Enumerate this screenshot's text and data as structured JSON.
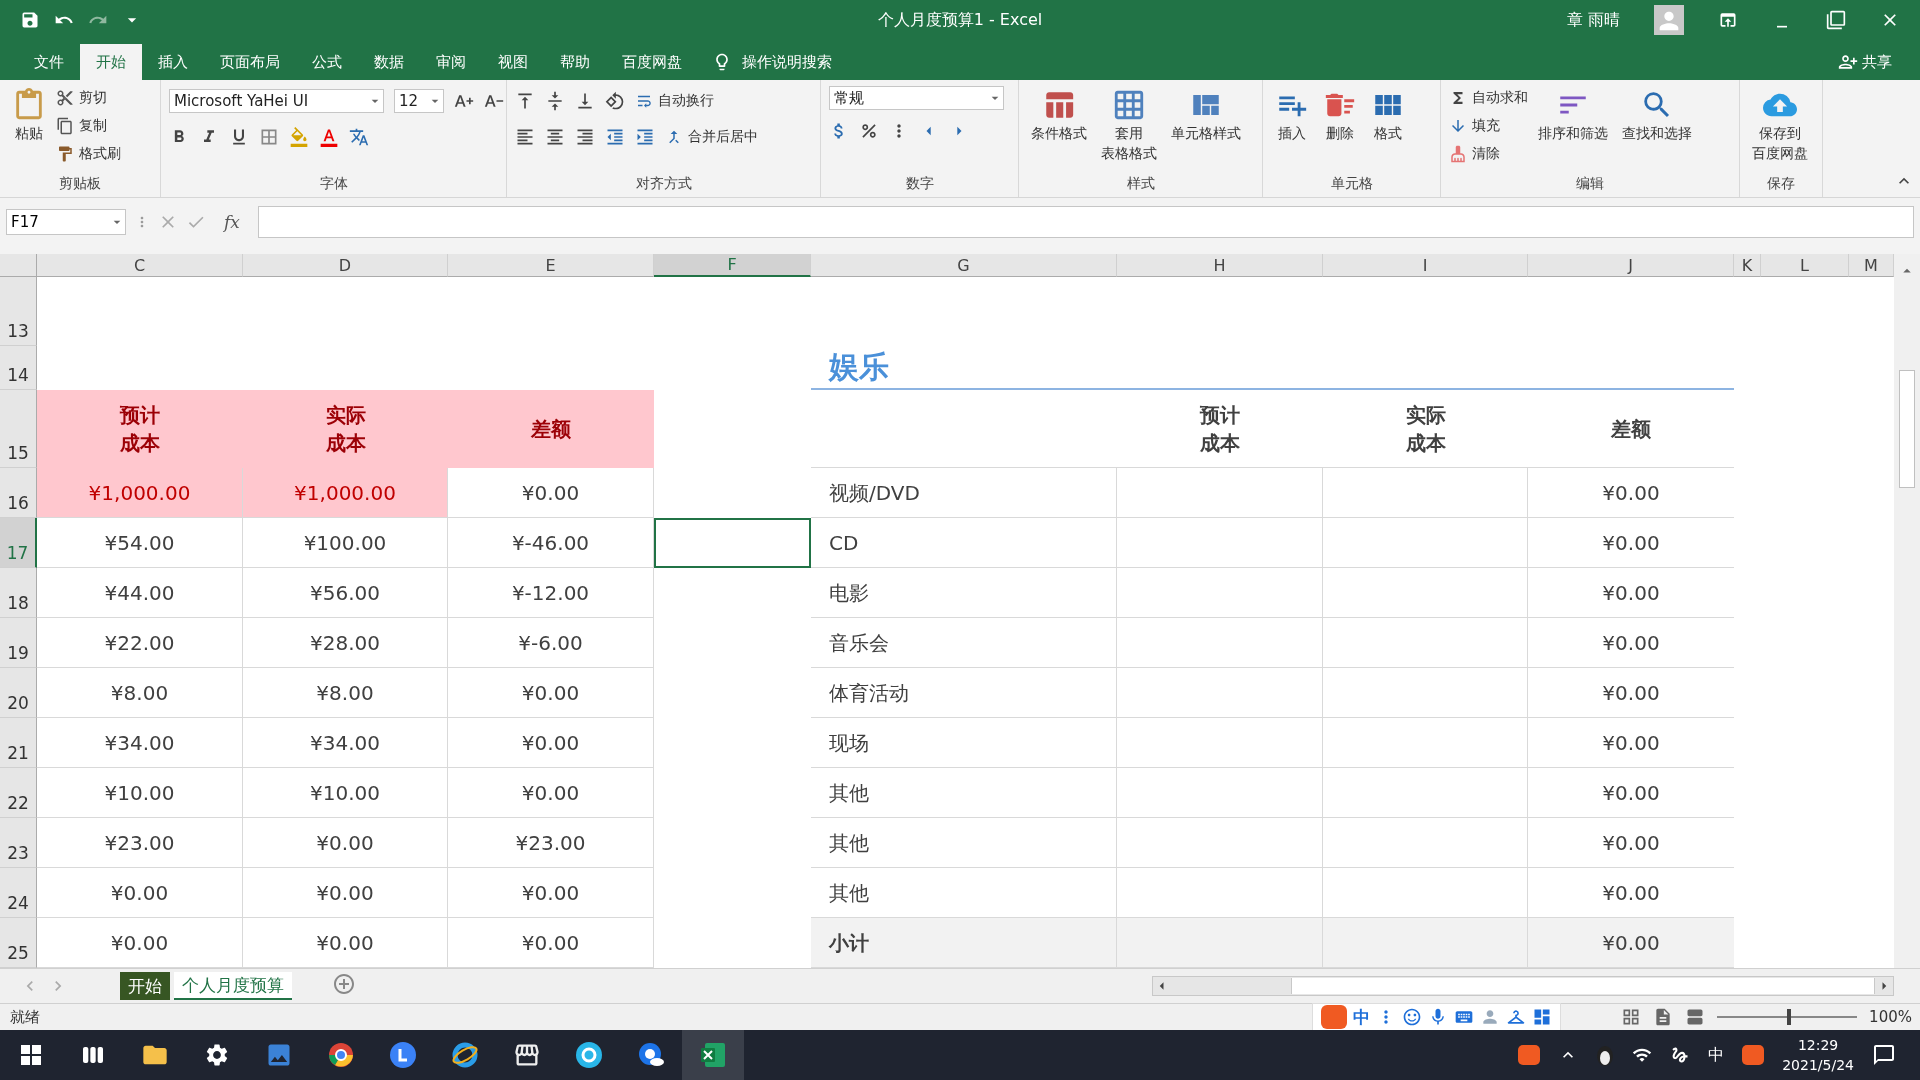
{
  "title_bar": {
    "title": "个人月度预算1 - Excel",
    "user": "章 雨晴"
  },
  "menu_tabs": [
    {
      "label": "文件",
      "selected": false
    },
    {
      "label": "开始",
      "selected": true
    },
    {
      "label": "插入",
      "selected": false
    },
    {
      "label": "页面布局",
      "selected": false
    },
    {
      "label": "公式",
      "selected": false
    },
    {
      "label": "数据",
      "selected": false
    },
    {
      "label": "审阅",
      "selected": false
    },
    {
      "label": "视图",
      "selected": false
    },
    {
      "label": "帮助",
      "selected": false
    },
    {
      "label": "百度网盘",
      "selected": false
    }
  ],
  "tell_me": "操作说明搜索",
  "share": "共享",
  "ribbon": [
    {
      "kind": "clipboard",
      "label": "剪贴板",
      "buttons": [
        [
          "粘贴"
        ],
        [
          "剪切"
        ],
        [
          "复制"
        ],
        [
          "格式刷"
        ]
      ]
    },
    {
      "kind": "font",
      "label": "字体",
      "font": "Microsoft YaHei UI",
      "size": "12"
    },
    {
      "kind": "alignment",
      "label": "对齐方式",
      "buttons": [
        [
          "自动换行"
        ],
        [
          "合并后居中"
        ]
      ]
    },
    {
      "kind": "number",
      "label": "数字",
      "format": "常规"
    },
    {
      "kind": "styles",
      "label": "样式",
      "buttons": [
        [
          "条件格式"
        ],
        [
          "套用",
          "表格格式"
        ],
        [
          "单元格样式"
        ]
      ]
    },
    {
      "kind": "cells",
      "label": "单元格",
      "buttons": [
        [
          "插入"
        ],
        [
          "删除"
        ],
        [
          "格式"
        ]
      ]
    },
    {
      "kind": "editing",
      "label": "编辑",
      "buttons": [
        [
          "自动求和"
        ],
        [
          "填充"
        ],
        [
          "清除"
        ],
        [
          "排序和筛选"
        ],
        [
          "查找和选择"
        ]
      ]
    },
    {
      "kind": "save",
      "label": "保存",
      "buttons": [
        [
          "保存到",
          "百度网盘"
        ]
      ]
    }
  ],
  "name_box": "F17",
  "fx": "fx",
  "columns": [
    {
      "label": "C",
      "selected": false
    },
    {
      "label": "D",
      "selected": false
    },
    {
      "label": "E",
      "selected": false
    },
    {
      "label": "F",
      "selected": true
    },
    {
      "label": "G",
      "selected": false
    },
    {
      "label": "H",
      "selected": false
    },
    {
      "label": "I",
      "selected": false
    },
    {
      "label": "J",
      "selected": false
    },
    {
      "label": "K",
      "selected": false
    },
    {
      "label": "L",
      "selected": false
    },
    {
      "label": "M",
      "selected": false
    }
  ],
  "rows": [
    {
      "number": "13",
      "selected": false
    },
    {
      "number": "14",
      "selected": false,
      "right": {
        "kind": "title",
        "label": "娱乐"
      }
    },
    {
      "number": "15",
      "selected": false,
      "left": [
        {
          "text": "预计成本",
          "kind": "header"
        },
        {
          "text": "实际成本",
          "kind": "header"
        },
        {
          "text": "差额",
          "kind": "header"
        }
      ],
      "right": {
        "kind": "head",
        "estimate": "预计成本",
        "actual": "实际成本",
        "difference": "差额"
      }
    },
    {
      "number": "16",
      "selected": false,
      "left": [
        {
          "text": "¥1,000.00",
          "kind": "highlight"
        },
        {
          "text": "¥1,000.00",
          "kind": "highlight"
        },
        {
          "text": "¥0.00",
          "kind": "value"
        }
      ],
      "right": {
        "kind": "body",
        "label": "视频/DVD",
        "difference": "¥0.00"
      }
    },
    {
      "number": "17",
      "selected": true,
      "left": [
        {
          "text": "¥54.00",
          "kind": "value"
        },
        {
          "text": "¥100.00",
          "kind": "value"
        },
        {
          "text": "¥-46.00",
          "kind": "value"
        }
      ],
      "right": {
        "kind": "body",
        "label": "CD",
        "difference": "¥0.00"
      }
    },
    {
      "number": "18",
      "selected": false,
      "left": [
        {
          "text": "¥44.00",
          "kind": "value"
        },
        {
          "text": "¥56.00",
          "kind": "value"
        },
        {
          "text": "¥-12.00",
          "kind": "value"
        }
      ],
      "right": {
        "kind": "body",
        "label": "电影",
        "difference": "¥0.00"
      }
    },
    {
      "number": "19",
      "selected": false,
      "left": [
        {
          "text": "¥22.00",
          "kind": "value"
        },
        {
          "text": "¥28.00",
          "kind": "value"
        },
        {
          "text": "¥-6.00",
          "kind": "value"
        }
      ],
      "right": {
        "kind": "body",
        "label": "音乐会",
        "difference": "¥0.00"
      }
    },
    {
      "number": "20",
      "selected": false,
      "left": [
        {
          "text": "¥8.00",
          "kind": "value"
        },
        {
          "text": "¥8.00",
          "kind": "value"
        },
        {
          "text": "¥0.00",
          "kind": "value"
        }
      ],
      "right": {
        "kind": "body",
        "label": "体育活动",
        "difference": "¥0.00"
      }
    },
    {
      "number": "21",
      "selected": false,
      "left": [
        {
          "text": "¥34.00",
          "kind": "value"
        },
        {
          "text": "¥34.00",
          "kind": "value"
        },
        {
          "text": "¥0.00",
          "kind": "value"
        }
      ],
      "right": {
        "kind": "body",
        "label": "现场",
        "difference": "¥0.00"
      }
    },
    {
      "number": "22",
      "selected": false,
      "left": [
        {
          "text": "¥10.00",
          "kind": "value"
        },
        {
          "text": "¥10.00",
          "kind": "value"
        },
        {
          "text": "¥0.00",
          "kind": "value"
        }
      ],
      "right": {
        "kind": "body",
        "label": "其他",
        "difference": "¥0.00"
      }
    },
    {
      "number": "23",
      "selected": false,
      "left": [
        {
          "text": "¥23.00",
          "kind": "value"
        },
        {
          "text": "¥0.00",
          "kind": "value"
        },
        {
          "text": "¥23.00",
          "kind": "value"
        }
      ],
      "right": {
        "kind": "body",
        "label": "其他",
        "difference": "¥0.00"
      }
    },
    {
      "number": "24",
      "selected": false,
      "left": [
        {
          "text": "¥0.00",
          "kind": "value"
        },
        {
          "text": "¥0.00",
          "kind": "value"
        },
        {
          "text": "¥0.00",
          "kind": "value"
        }
      ],
      "right": {
        "kind": "body",
        "label": "其他",
        "difference": "¥0.00"
      }
    },
    {
      "number": "25",
      "selected": false,
      "left": [
        {
          "text": "¥0.00",
          "kind": "value"
        },
        {
          "text": "¥0.00",
          "kind": "value"
        },
        {
          "text": "¥0.00",
          "kind": "value"
        }
      ],
      "right": {
        "kind": "total",
        "label": "小计",
        "difference": "¥0.00"
      }
    }
  ],
  "sheet_tabs": [
    {
      "label": "开始",
      "selected": false,
      "color": "#375623"
    },
    {
      "label": "个人月度预算",
      "selected": true
    }
  ],
  "status": "就绪",
  "ime_mode": "中",
  "zoom_slider": {
    "level": 0.5
  },
  "zoom": "100%",
  "taskbar": {
    "ime": "中",
    "time": "12:29",
    "date": "2021/5/24"
  }
}
